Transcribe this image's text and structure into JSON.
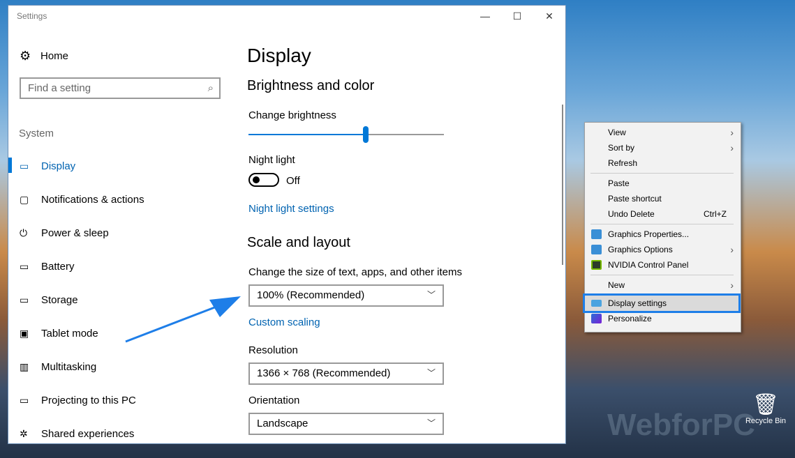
{
  "window": {
    "title": "Settings",
    "minimize": "—",
    "maximize": "☐",
    "close": "✕"
  },
  "sidebar": {
    "home": "Home",
    "search_placeholder": "Find a setting",
    "section": "System",
    "items": [
      {
        "label": "Display",
        "icon": "▭"
      },
      {
        "label": "Notifications & actions",
        "icon": "▢"
      },
      {
        "label": "Power & sleep",
        "icon": "⏻"
      },
      {
        "label": "Battery",
        "icon": "▭"
      },
      {
        "label": "Storage",
        "icon": "▭"
      },
      {
        "label": "Tablet mode",
        "icon": "▣"
      },
      {
        "label": "Multitasking",
        "icon": "▥"
      },
      {
        "label": "Projecting to this PC",
        "icon": "▭"
      },
      {
        "label": "Shared experiences",
        "icon": "✲"
      }
    ]
  },
  "main": {
    "title": "Display",
    "brightness_heading": "Brightness and color",
    "change_brightness": "Change brightness",
    "brightness_percent": 60,
    "night_light": "Night light",
    "night_light_state": "Off",
    "night_light_settings": "Night light settings",
    "scale_heading": "Scale and layout",
    "scale_label": "Change the size of text, apps, and other items",
    "scale_value": "100% (Recommended)",
    "custom_scaling": "Custom scaling",
    "resolution_label": "Resolution",
    "resolution_value": "1366 × 768 (Recommended)",
    "orientation_label": "Orientation",
    "orientation_value": "Landscape"
  },
  "context_menu": {
    "view": "View",
    "sort_by": "Sort by",
    "refresh": "Refresh",
    "paste": "Paste",
    "paste_shortcut": "Paste shortcut",
    "undo_delete": "Undo Delete",
    "undo_shortcut": "Ctrl+Z",
    "graphics_properties": "Graphics Properties...",
    "graphics_options": "Graphics Options",
    "nvidia": "NVIDIA Control Panel",
    "new": "New",
    "display_settings": "Display settings",
    "personalize": "Personalize"
  },
  "desktop": {
    "recycle_bin": "Recycle Bin",
    "watermark": "WebforPC"
  },
  "colors": {
    "accent": "#0078d7",
    "highlight": "#1e7ee8"
  }
}
